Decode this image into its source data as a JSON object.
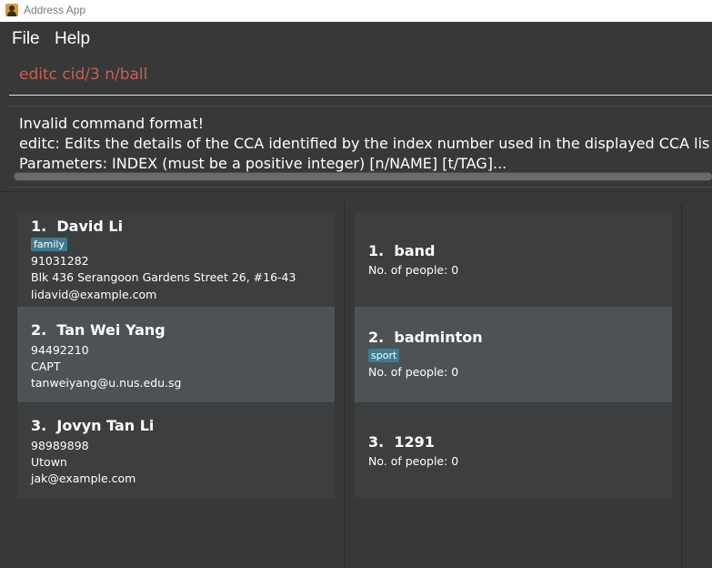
{
  "window": {
    "title": "Address App",
    "icon": "app-icon"
  },
  "menu": {
    "file": "File",
    "help": "Help"
  },
  "command": {
    "value": "editc cid/3 n/ball"
  },
  "result": {
    "lines": [
      "Invalid command format!",
      "editc: Edits the details of the CCA identified by the index number used in the displayed CCA list. Existing values will be overwritten by the input values.",
      "Parameters: INDEX (must be a positive integer) [n/NAME] [t/TAG]..."
    ]
  },
  "persons": [
    {
      "index": "1.",
      "name": "David Li",
      "tag": "family",
      "phone": "91031282",
      "address": "Blk 436 Serangoon Gardens Street 26, #16-43",
      "email": "lidavid@example.com"
    },
    {
      "index": "2.",
      "name": "Tan Wei Yang",
      "phone": "94492210",
      "address": "CAPT",
      "email": "tanweiyang@u.nus.edu.sg"
    },
    {
      "index": "3.",
      "name": "Jovyn Tan Li",
      "phone": "98989898",
      "address": "Utown",
      "email": "jak@example.com"
    }
  ],
  "ccas": [
    {
      "index": "1.",
      "name": "band",
      "people": "No. of people: 0"
    },
    {
      "index": "2.",
      "name": "badminton",
      "tag": "sport",
      "people": "No. of people: 0"
    },
    {
      "index": "3.",
      "name": "1291",
      "people": "No. of people: 0"
    }
  ],
  "colors": {
    "tag": "#3e7b91",
    "command_text": "#c9604f",
    "background": "#383838"
  }
}
